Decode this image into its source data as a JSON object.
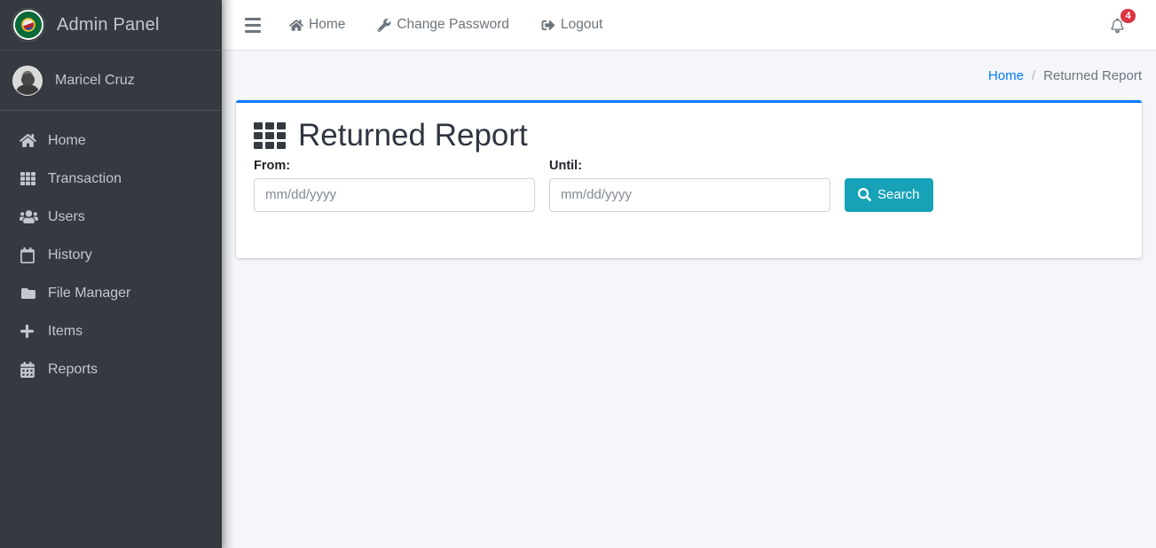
{
  "sidebar": {
    "brand": {
      "title": "Admin Panel",
      "logo_icon": "seal-logo-icon"
    },
    "user": {
      "name": "Maricel Cruz",
      "avatar_icon": "avatar"
    },
    "items": [
      {
        "label": "Home",
        "icon": "home-icon"
      },
      {
        "label": "Transaction",
        "icon": "grid-icon"
      },
      {
        "label": "Users",
        "icon": "users-icon"
      },
      {
        "label": "History",
        "icon": "calendar-icon"
      },
      {
        "label": "File Manager",
        "icon": "folder-icon"
      },
      {
        "label": "Items",
        "icon": "plus-icon"
      },
      {
        "label": "Reports",
        "icon": "calendar-grid-icon"
      }
    ]
  },
  "navbar": {
    "toggle_icon": "hamburger-icon",
    "links": [
      {
        "label": "Home",
        "icon": "home-icon"
      },
      {
        "label": "Change Password",
        "icon": "wrench-icon"
      },
      {
        "label": "Logout",
        "icon": "sign-out-icon"
      }
    ],
    "notifications": {
      "icon": "bell-icon",
      "count": "4"
    }
  },
  "breadcrumb": {
    "home": "Home",
    "separator": "/",
    "current": "Returned Report"
  },
  "card": {
    "title": "Returned Report",
    "title_icon": "grid-icon",
    "from": {
      "label": "From:",
      "value": "",
      "placeholder": "mm/dd/yyyy"
    },
    "until": {
      "label": "Until:",
      "value": "",
      "placeholder": "mm/dd/yyyy"
    },
    "search_button": {
      "label": "Search",
      "icon": "search-icon"
    }
  },
  "colors": {
    "sidebar_bg": "#343a40",
    "accent_blue": "#007bff",
    "teal": "#17a2b8",
    "badge_red": "#dc3545",
    "content_bg": "#f4f6f9"
  }
}
